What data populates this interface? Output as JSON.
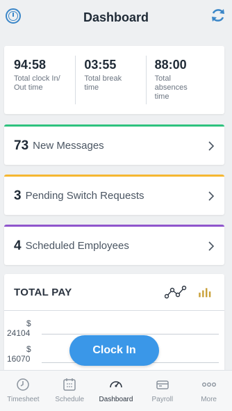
{
  "header": {
    "title": "Dashboard",
    "logo_icon": "app-logo-icon",
    "refresh_icon": "refresh-icon"
  },
  "stats": [
    {
      "value": "94:58",
      "label": "Total clock In/ Out time"
    },
    {
      "value": "03:55",
      "label": "Total break time"
    },
    {
      "value": "88:00",
      "label": "Total absences time"
    }
  ],
  "rows": [
    {
      "count": "73",
      "label": "New Messages",
      "accent": "#2ec27e"
    },
    {
      "count": "3",
      "label": "Pending Switch Requests",
      "accent": "#f5b731"
    },
    {
      "count": "4",
      "label": "Scheduled Employees",
      "accent": "#8f55cc"
    }
  ],
  "pay": {
    "title": "TOTAL PAY",
    "y_ticks": [
      {
        "currency": "$",
        "amount": "24104"
      },
      {
        "currency": "$",
        "amount": "16070"
      }
    ]
  },
  "clock_in": {
    "label": "Clock In",
    "color": "#3a97e8"
  },
  "tabs": [
    {
      "label": "Timesheet",
      "icon": "clock-icon"
    },
    {
      "label": "Schedule",
      "icon": "calendar-icon"
    },
    {
      "label": "Dashboard",
      "icon": "speedometer-icon",
      "active": true
    },
    {
      "label": "Payroll",
      "icon": "wallet-icon"
    },
    {
      "label": "More",
      "icon": "more-dots-icon"
    }
  ]
}
